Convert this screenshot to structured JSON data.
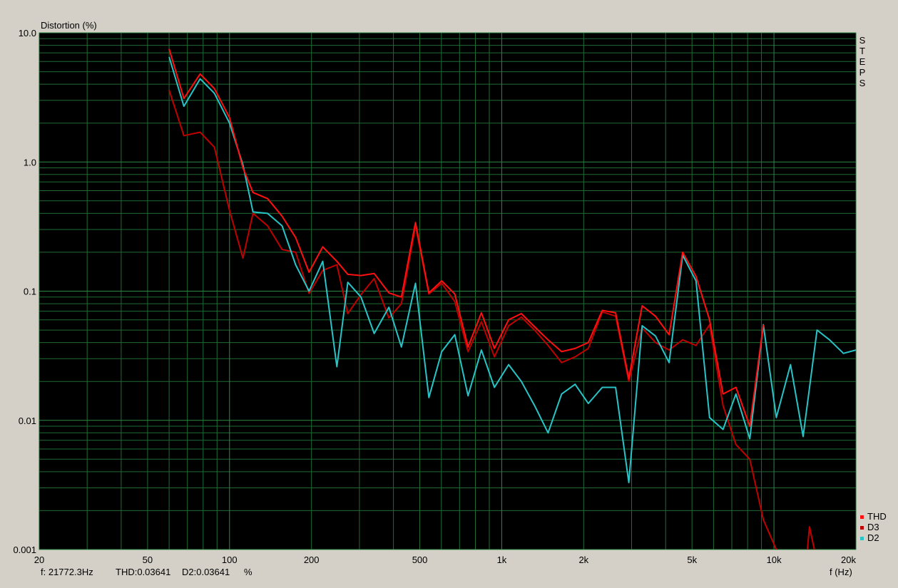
{
  "chart_data": {
    "type": "line",
    "ylabel": "Distortion (%)",
    "xlabel": "f (Hz)",
    "x_scale": "log",
    "y_scale": "log",
    "xlim": [
      20,
      20000
    ],
    "ylim": [
      0.001,
      10
    ],
    "grid": true,
    "legend_placement": "bottom-right",
    "side_label": "STEPS",
    "background_color": "#000000",
    "grid_color": "#1f6b32",
    "x_ticks": [
      {
        "value": 20,
        "label": "20"
      },
      {
        "value": 50,
        "label": "50"
      },
      {
        "value": 100,
        "label": "100"
      },
      {
        "value": 200,
        "label": "200"
      },
      {
        "value": 500,
        "label": "500"
      },
      {
        "value": 1000,
        "label": "1k"
      },
      {
        "value": 2000,
        "label": "2k"
      },
      {
        "value": 5000,
        "label": "5k"
      },
      {
        "value": 10000,
        "label": "10k"
      },
      {
        "value": 20000,
        "label": "20k"
      }
    ],
    "y_ticks": [
      {
        "value": 10,
        "label": "10.0"
      },
      {
        "value": 1,
        "label": "1.0"
      },
      {
        "value": 0.1,
        "label": "0.1"
      },
      {
        "value": 0.01,
        "label": "0.01"
      },
      {
        "value": 0.001,
        "label": "0.001"
      }
    ],
    "series": [
      {
        "name": "THD",
        "color": "#ff1010",
        "points": [
          [
            60,
            7.5
          ],
          [
            68,
            3.1
          ],
          [
            78,
            4.8
          ],
          [
            88,
            3.7
          ],
          [
            100,
            2.2
          ],
          [
            112,
            0.9
          ],
          [
            122,
            0.58
          ],
          [
            138,
            0.52
          ],
          [
            156,
            0.38
          ],
          [
            175,
            0.26
          ],
          [
            196,
            0.14
          ],
          [
            220,
            0.22
          ],
          [
            248,
            0.17
          ],
          [
            272,
            0.135
          ],
          [
            304,
            0.132
          ],
          [
            340,
            0.137
          ],
          [
            385,
            0.097
          ],
          [
            428,
            0.09
          ],
          [
            482,
            0.34
          ],
          [
            540,
            0.097
          ],
          [
            602,
            0.12
          ],
          [
            672,
            0.095
          ],
          [
            752,
            0.037
          ],
          [
            842,
            0.068
          ],
          [
            940,
            0.036
          ],
          [
            1060,
            0.06
          ],
          [
            1180,
            0.067
          ],
          [
            1320,
            0.053
          ],
          [
            1480,
            0.042
          ],
          [
            1660,
            0.034
          ],
          [
            1860,
            0.036
          ],
          [
            2080,
            0.04
          ],
          [
            2340,
            0.071
          ],
          [
            2620,
            0.068
          ],
          [
            2930,
            0.021
          ],
          [
            3280,
            0.077
          ],
          [
            3670,
            0.064
          ],
          [
            4120,
            0.046
          ],
          [
            4620,
            0.2
          ],
          [
            5170,
            0.13
          ],
          [
            5800,
            0.06
          ],
          [
            6500,
            0.016
          ],
          [
            7250,
            0.018
          ],
          [
            8150,
            0.009
          ],
          [
            9140,
            0.055
          ]
        ]
      },
      {
        "name": "D3",
        "color": "#c00000",
        "points": [
          [
            60,
            3.6
          ],
          [
            68,
            1.6
          ],
          [
            78,
            1.7
          ],
          [
            88,
            1.3
          ],
          [
            100,
            0.42
          ],
          [
            112,
            0.18
          ],
          [
            122,
            0.4
          ],
          [
            138,
            0.32
          ],
          [
            156,
            0.21
          ],
          [
            175,
            0.2
          ],
          [
            196,
            0.096
          ],
          [
            220,
            0.145
          ],
          [
            248,
            0.16
          ],
          [
            272,
            0.067
          ],
          [
            304,
            0.094
          ],
          [
            340,
            0.125
          ],
          [
            385,
            0.062
          ],
          [
            428,
            0.08
          ],
          [
            482,
            0.32
          ],
          [
            540,
            0.095
          ],
          [
            602,
            0.115
          ],
          [
            672,
            0.083
          ],
          [
            752,
            0.034
          ],
          [
            842,
            0.058
          ],
          [
            940,
            0.031
          ],
          [
            1060,
            0.054
          ],
          [
            1180,
            0.063
          ],
          [
            1320,
            0.05
          ],
          [
            1480,
            0.038
          ],
          [
            1660,
            0.028
          ],
          [
            1860,
            0.031
          ],
          [
            2080,
            0.036
          ],
          [
            2340,
            0.069
          ],
          [
            2620,
            0.064
          ],
          [
            2930,
            0.02
          ],
          [
            3280,
            0.052
          ],
          [
            3670,
            0.04
          ],
          [
            4120,
            0.035
          ],
          [
            4620,
            0.042
          ],
          [
            5170,
            0.038
          ],
          [
            5800,
            0.055
          ],
          [
            6500,
            0.013
          ],
          [
            7250,
            0.0065
          ],
          [
            8150,
            0.005
          ],
          [
            9140,
            0.0017
          ],
          [
            10200,
            0.001
          ],
          [
            11500,
            0.0006
          ],
          [
            12800,
            0.00045
          ],
          [
            13500,
            0.0015
          ],
          [
            14400,
            0.0008
          ],
          [
            16000,
            0.0004
          ]
        ]
      },
      {
        "name": "D2",
        "color": "#27c4c8",
        "points": [
          [
            60,
            6.5
          ],
          [
            68,
            2.7
          ],
          [
            78,
            4.4
          ],
          [
            88,
            3.4
          ],
          [
            100,
            2.0
          ],
          [
            112,
            0.95
          ],
          [
            122,
            0.41
          ],
          [
            138,
            0.4
          ],
          [
            156,
            0.32
          ],
          [
            175,
            0.16
          ],
          [
            196,
            0.1
          ],
          [
            220,
            0.17
          ],
          [
            248,
            0.026
          ],
          [
            272,
            0.117
          ],
          [
            304,
            0.09
          ],
          [
            340,
            0.047
          ],
          [
            385,
            0.075
          ],
          [
            428,
            0.037
          ],
          [
            482,
            0.115
          ],
          [
            540,
            0.015
          ],
          [
            602,
            0.034
          ],
          [
            672,
            0.046
          ],
          [
            752,
            0.0155
          ],
          [
            842,
            0.035
          ],
          [
            940,
            0.018
          ],
          [
            1060,
            0.027
          ],
          [
            1180,
            0.02
          ],
          [
            1320,
            0.013
          ],
          [
            1480,
            0.008
          ],
          [
            1660,
            0.016
          ],
          [
            1860,
            0.019
          ],
          [
            2080,
            0.0135
          ],
          [
            2340,
            0.018
          ],
          [
            2620,
            0.018
          ],
          [
            2930,
            0.0033
          ],
          [
            3280,
            0.054
          ],
          [
            3670,
            0.045
          ],
          [
            4120,
            0.028
          ],
          [
            4620,
            0.19
          ],
          [
            5170,
            0.12
          ],
          [
            5800,
            0.0105
          ],
          [
            6500,
            0.0085
          ],
          [
            7250,
            0.016
          ],
          [
            8150,
            0.0072
          ],
          [
            9140,
            0.055
          ],
          [
            10200,
            0.0105
          ],
          [
            11500,
            0.027
          ],
          [
            12800,
            0.0075
          ],
          [
            14400,
            0.05
          ],
          [
            16000,
            0.042
          ],
          [
            18000,
            0.033
          ],
          [
            20000,
            0.035
          ]
        ]
      }
    ]
  },
  "readout": {
    "frequency": "f: 21772.3Hz",
    "thd": "THD:0.03641",
    "d2": "D2:0.03641",
    "unit": "%"
  }
}
